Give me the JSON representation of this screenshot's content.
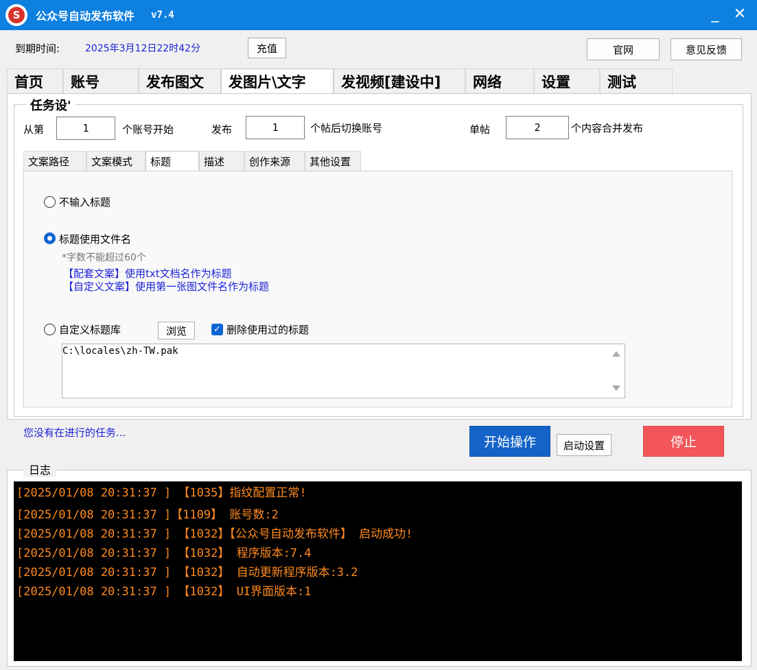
{
  "window": {
    "title": "公众号自动发布软件",
    "version": "v7.4",
    "minimize": "_",
    "close": "✕"
  },
  "header": {
    "expiry_label": "到期时间:",
    "expiry_value": "2025年3月12日22时42分",
    "recharge": "充值",
    "website": "官网",
    "feedback": "意见反馈"
  },
  "main_tabs": [
    "首页",
    "账号",
    "发布图文",
    "发图片\\文字",
    "发视频[建设中]",
    "网络",
    "设置",
    "测试"
  ],
  "task": {
    "legend": "任务设'",
    "from_label": "从第",
    "from_value": "1",
    "account_start": "个账号开始",
    "publish_label": "发布",
    "publish_value": "1",
    "switch_label": "个帖后切换账号",
    "single_label": "单帖",
    "single_value": "2",
    "merge_label": "个内容合并发布"
  },
  "sub_tabs": [
    "文案路径",
    "文案模式",
    "标题",
    "描述",
    "创作来源",
    "其他设置"
  ],
  "title_opts": {
    "no_title": "不输入标题",
    "use_filename": "标题使用文件名",
    "hint": "*字数不能超过60个",
    "note1": "【配套文案】使用txt文档名作为标题",
    "note2": "【自定义文案】使用第一张图文件名作为标题",
    "custom_lib": "自定义标题库",
    "browse": "浏览",
    "delete_used": "删除使用过的标题",
    "check_mark": "✓",
    "path": "C:\\locales\\zh-TW.pak"
  },
  "status": {
    "text": "您没有在进行的任务...",
    "start": "开始操作",
    "start_settings": "启动设置",
    "stop": "停止"
  },
  "log": {
    "title": "日志",
    "lines": [
      "[2025/01/08 20:31:37 ] 【1035】指纹配置正常!",
      "[2025/01/08 20:31:37 ]【1109】 账号数:2",
      "[2025/01/08 20:31:37 ] 【1032】【公众号自动发布软件】 启动成功!",
      "[2025/01/08 20:31:37 ] 【1032】 程序版本:7.4",
      "[2025/01/08 20:31:37 ] 【1032】 自动更新程序版本:3.2",
      "[2025/01/08 20:31:37 ] 【1032】 UI界面版本:1"
    ]
  },
  "colors": {
    "titlebar": "#0e80e0",
    "link_blue": "#1e22d6",
    "start_btn": "#1463c8",
    "stop_btn": "#f2565a",
    "log_text": "#ff8a1e"
  }
}
